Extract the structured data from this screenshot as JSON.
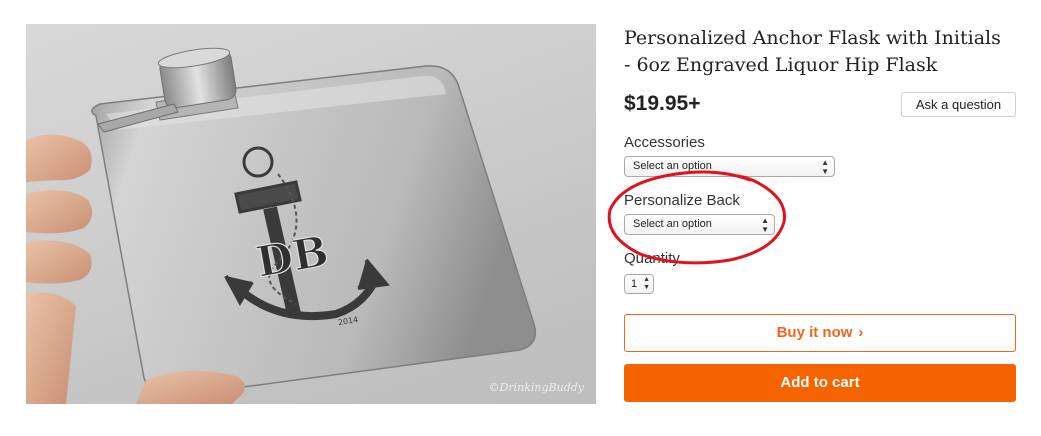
{
  "product": {
    "title": "Personalized Anchor Flask with Initials - 6oz Engraved Liquor Hip Flask",
    "price": "$19.95+",
    "ask_question_label": "Ask a question",
    "image": {
      "engraving_initials": "DB",
      "engraving_year": "2014",
      "watermark": "©DrinkingBuddy"
    }
  },
  "options": {
    "accessories": {
      "label": "Accessories",
      "selected": "Select an option"
    },
    "personalize_back": {
      "label": "Personalize Back",
      "selected": "Select an option"
    },
    "quantity": {
      "label": "Quantity",
      "selected": "1"
    }
  },
  "actions": {
    "buy_now_label": "Buy it now",
    "buy_now_icon": "chevron-right-icon",
    "add_to_cart_label": "Add to cart"
  },
  "colors": {
    "accent_orange": "#f56400",
    "annotation_red": "#e0121b"
  }
}
